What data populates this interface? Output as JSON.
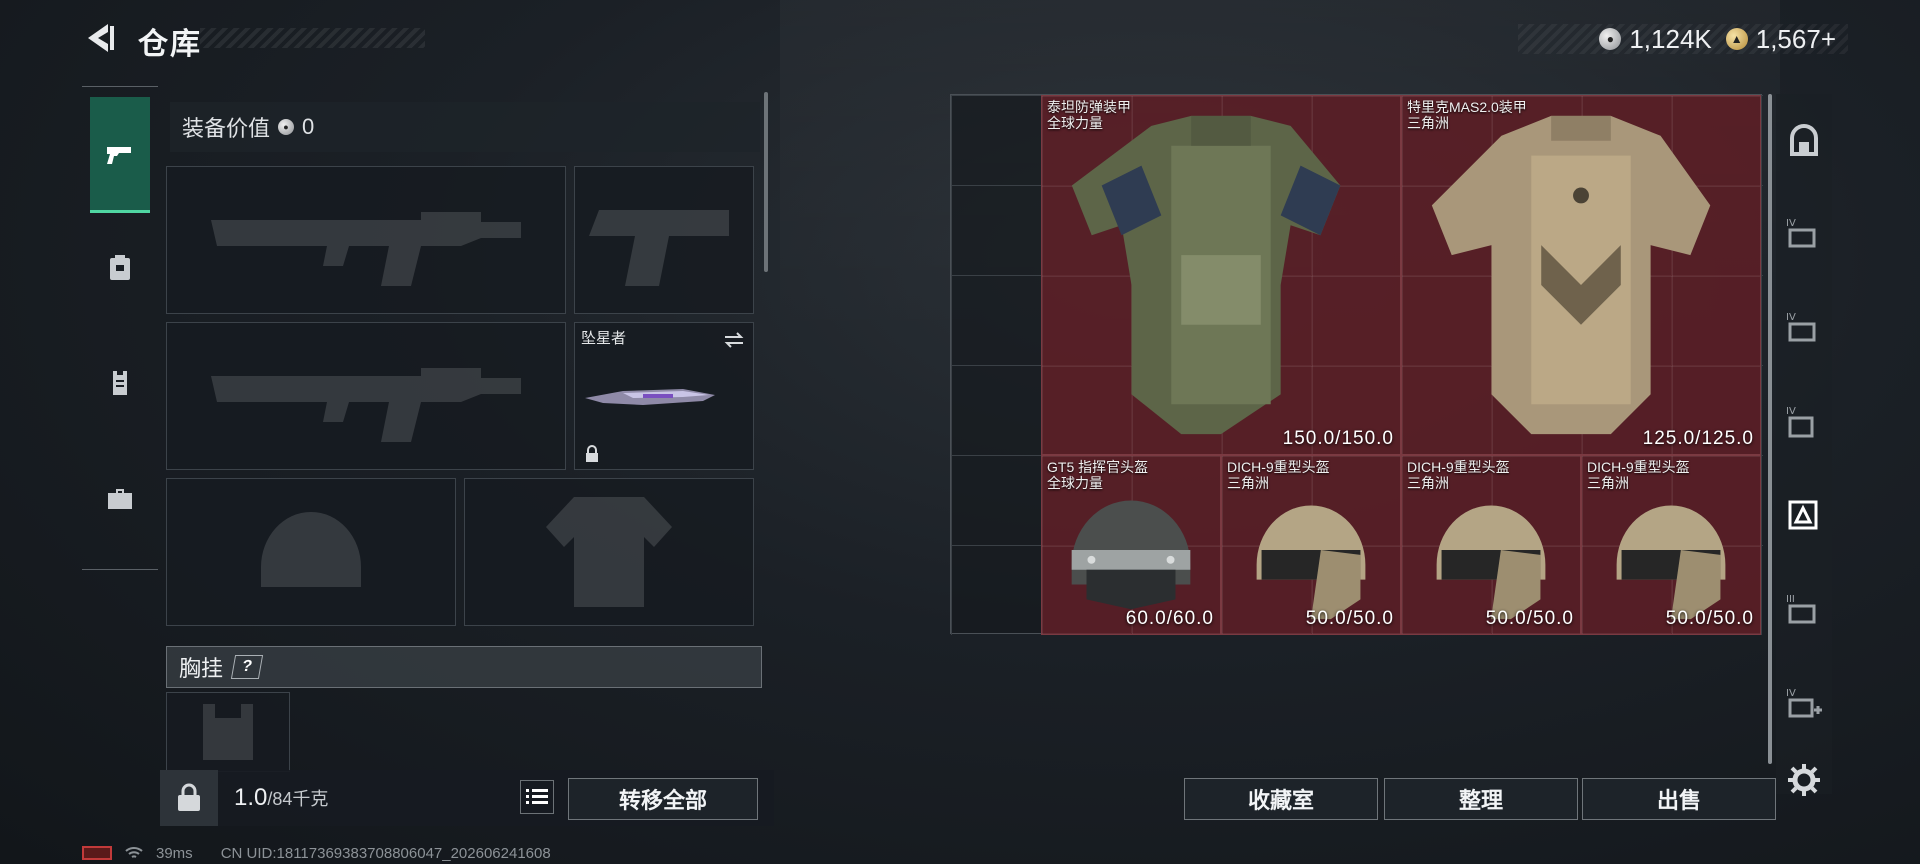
{
  "header": {
    "title": "仓库",
    "currency": [
      {
        "icon": "silver-coin-icon",
        "value": "1,124K"
      },
      {
        "icon": "gold-coin-icon",
        "value": "1,567+"
      }
    ]
  },
  "loadout": {
    "equip_value_label": "装备价值",
    "equip_value": "0",
    "melee_name": "坠星者",
    "section_label": "胸挂",
    "help": "?",
    "weight_current": "1.0",
    "weight_cap": "/84千克",
    "transfer_all": "转移全部"
  },
  "storage": {
    "items": [
      {
        "name_line1": "泰坦防弹装甲",
        "name_line2": "全球力量",
        "durability": "150.0/150.0"
      },
      {
        "name_line1": "特里克MAS2.0装甲",
        "name_line2": "三角洲",
        "durability": "125.0/125.0"
      },
      {
        "name_line1": "GT5 指挥官头盔",
        "name_line2": "全球力量",
        "durability": "60.0/60.0"
      },
      {
        "name_line1": "DICH-9重型头盔",
        "name_line2": "三角洲",
        "durability": "50.0/50.0"
      },
      {
        "name_line1": "DICH-9重型头盔",
        "name_line2": "三角洲",
        "durability": "50.0/50.0"
      },
      {
        "name_line1": "DICH-9重型头盔",
        "name_line2": "三角洲",
        "durability": "50.0/50.0"
      }
    ],
    "collection_btn": "收藏室",
    "sort_btn": "整理",
    "sell_btn": "出售"
  },
  "status": {
    "ping": "39ms",
    "uid": "CN UID:18117369383708806047_202606241608"
  },
  "colors": {
    "accent": "#4fd6a2",
    "item_bg": "#6e2028"
  }
}
